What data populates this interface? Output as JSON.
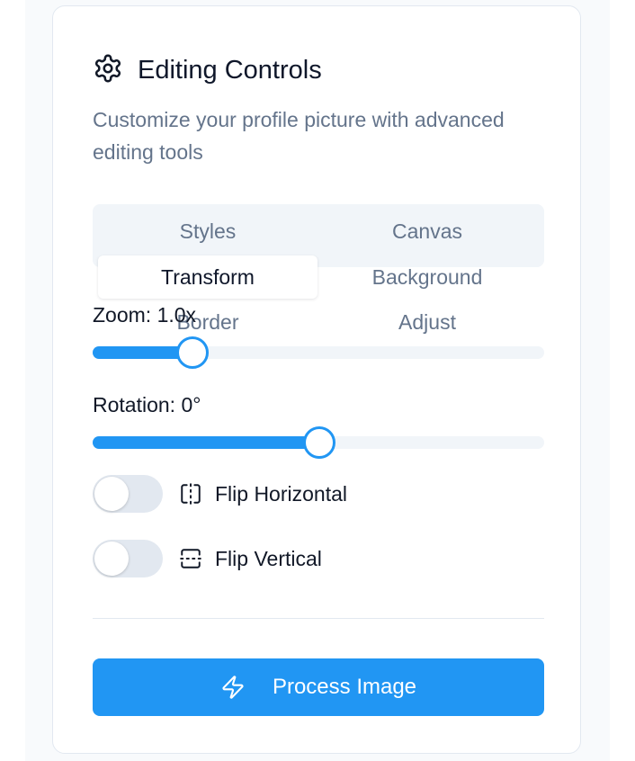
{
  "card": {
    "title": "Editing Controls",
    "description": "Customize your profile picture with advanced editing tools"
  },
  "tabs": [
    "Styles",
    "Canvas",
    "Transform",
    "Background",
    "Border",
    "Adjust"
  ],
  "active_tab": "Transform",
  "zoom": {
    "label": "Zoom: 1.0x",
    "value": 1.0,
    "fill_fraction": 0.22
  },
  "rotation": {
    "label": "Rotation: 0°",
    "value": 0,
    "fill_fraction": 0.5
  },
  "flip_horizontal": {
    "label": "Flip Horizontal",
    "enabled": false,
    "icon": "flip-horizontal-icon"
  },
  "flip_vertical": {
    "label": "Flip Vertical",
    "enabled": false,
    "icon": "flip-vertical-icon"
  },
  "process_button": {
    "label": "Process Image",
    "icon": "zap-icon"
  },
  "colors": {
    "accent": "#2196f3",
    "muted": "#64748b",
    "track": "#f1f5f9",
    "switch_off": "#e2e8f0"
  }
}
